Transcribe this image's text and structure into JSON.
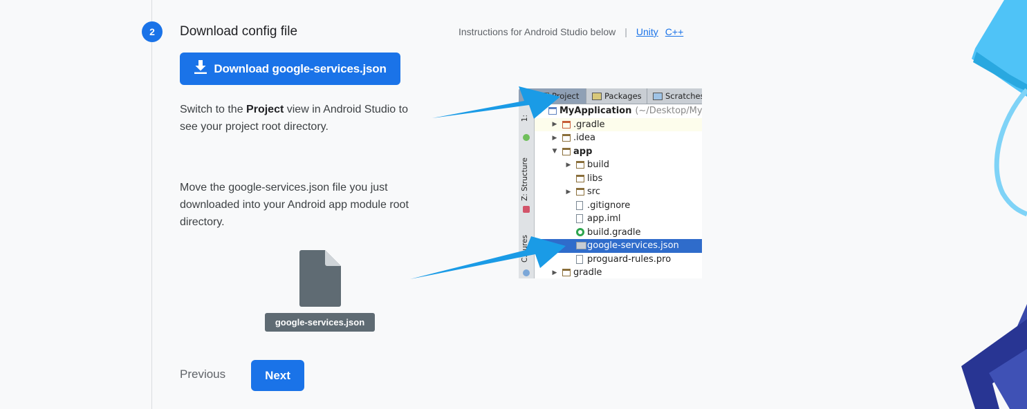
{
  "step": {
    "number": "2",
    "title": "Download config file",
    "instructions_text": "Instructions for Android Studio below",
    "separator": "|",
    "link_unity": "Unity",
    "link_cpp": "C++"
  },
  "download_button": {
    "label": "Download google-services.json",
    "icon": "download-icon"
  },
  "paragraph_project": {
    "before": "Switch to the ",
    "bold": "Project",
    "after": " view in Android Studio to see your project root directory."
  },
  "paragraph_move": "Move the google-services.json file you just downloaded into your Android app module root directory.",
  "file_chip": "google-services.json",
  "nav": {
    "previous": "Previous",
    "next": "Next"
  },
  "ide": {
    "tabs": [
      "Project",
      "Packages",
      "Scratches"
    ],
    "side_labels": [
      "1:",
      "Z: Structure",
      "C...ures"
    ],
    "tree": [
      {
        "label": "MyApplication",
        "suffix": "(~/Desktop/My",
        "icon": "project-folder-icon",
        "expanded": true
      },
      {
        "label": ".gradle",
        "icon": "folder-icon",
        "expanded": false
      },
      {
        "label": ".idea",
        "icon": "folder-icon",
        "expanded": false
      },
      {
        "label": "app",
        "icon": "module-folder-icon",
        "expanded": true
      },
      {
        "label": "build",
        "icon": "folder-icon",
        "expanded": false
      },
      {
        "label": "libs",
        "icon": "folder-icon"
      },
      {
        "label": "src",
        "icon": "folder-icon",
        "expanded": false
      },
      {
        "label": ".gitignore",
        "icon": "file-icon"
      },
      {
        "label": "app.iml",
        "icon": "file-icon"
      },
      {
        "label": "build.gradle",
        "icon": "gradle-icon"
      },
      {
        "label": "google-services.json",
        "icon": "json-file-icon",
        "selected": true
      },
      {
        "label": "proguard-rules.pro",
        "icon": "file-icon"
      },
      {
        "label": "gradle",
        "icon": "folder-icon",
        "expanded": false
      }
    ]
  },
  "colors": {
    "primary": "#1a73e8",
    "arrow": "#1a9be6",
    "file_chip": "#5f6b73",
    "selection": "#2f6ccb"
  }
}
